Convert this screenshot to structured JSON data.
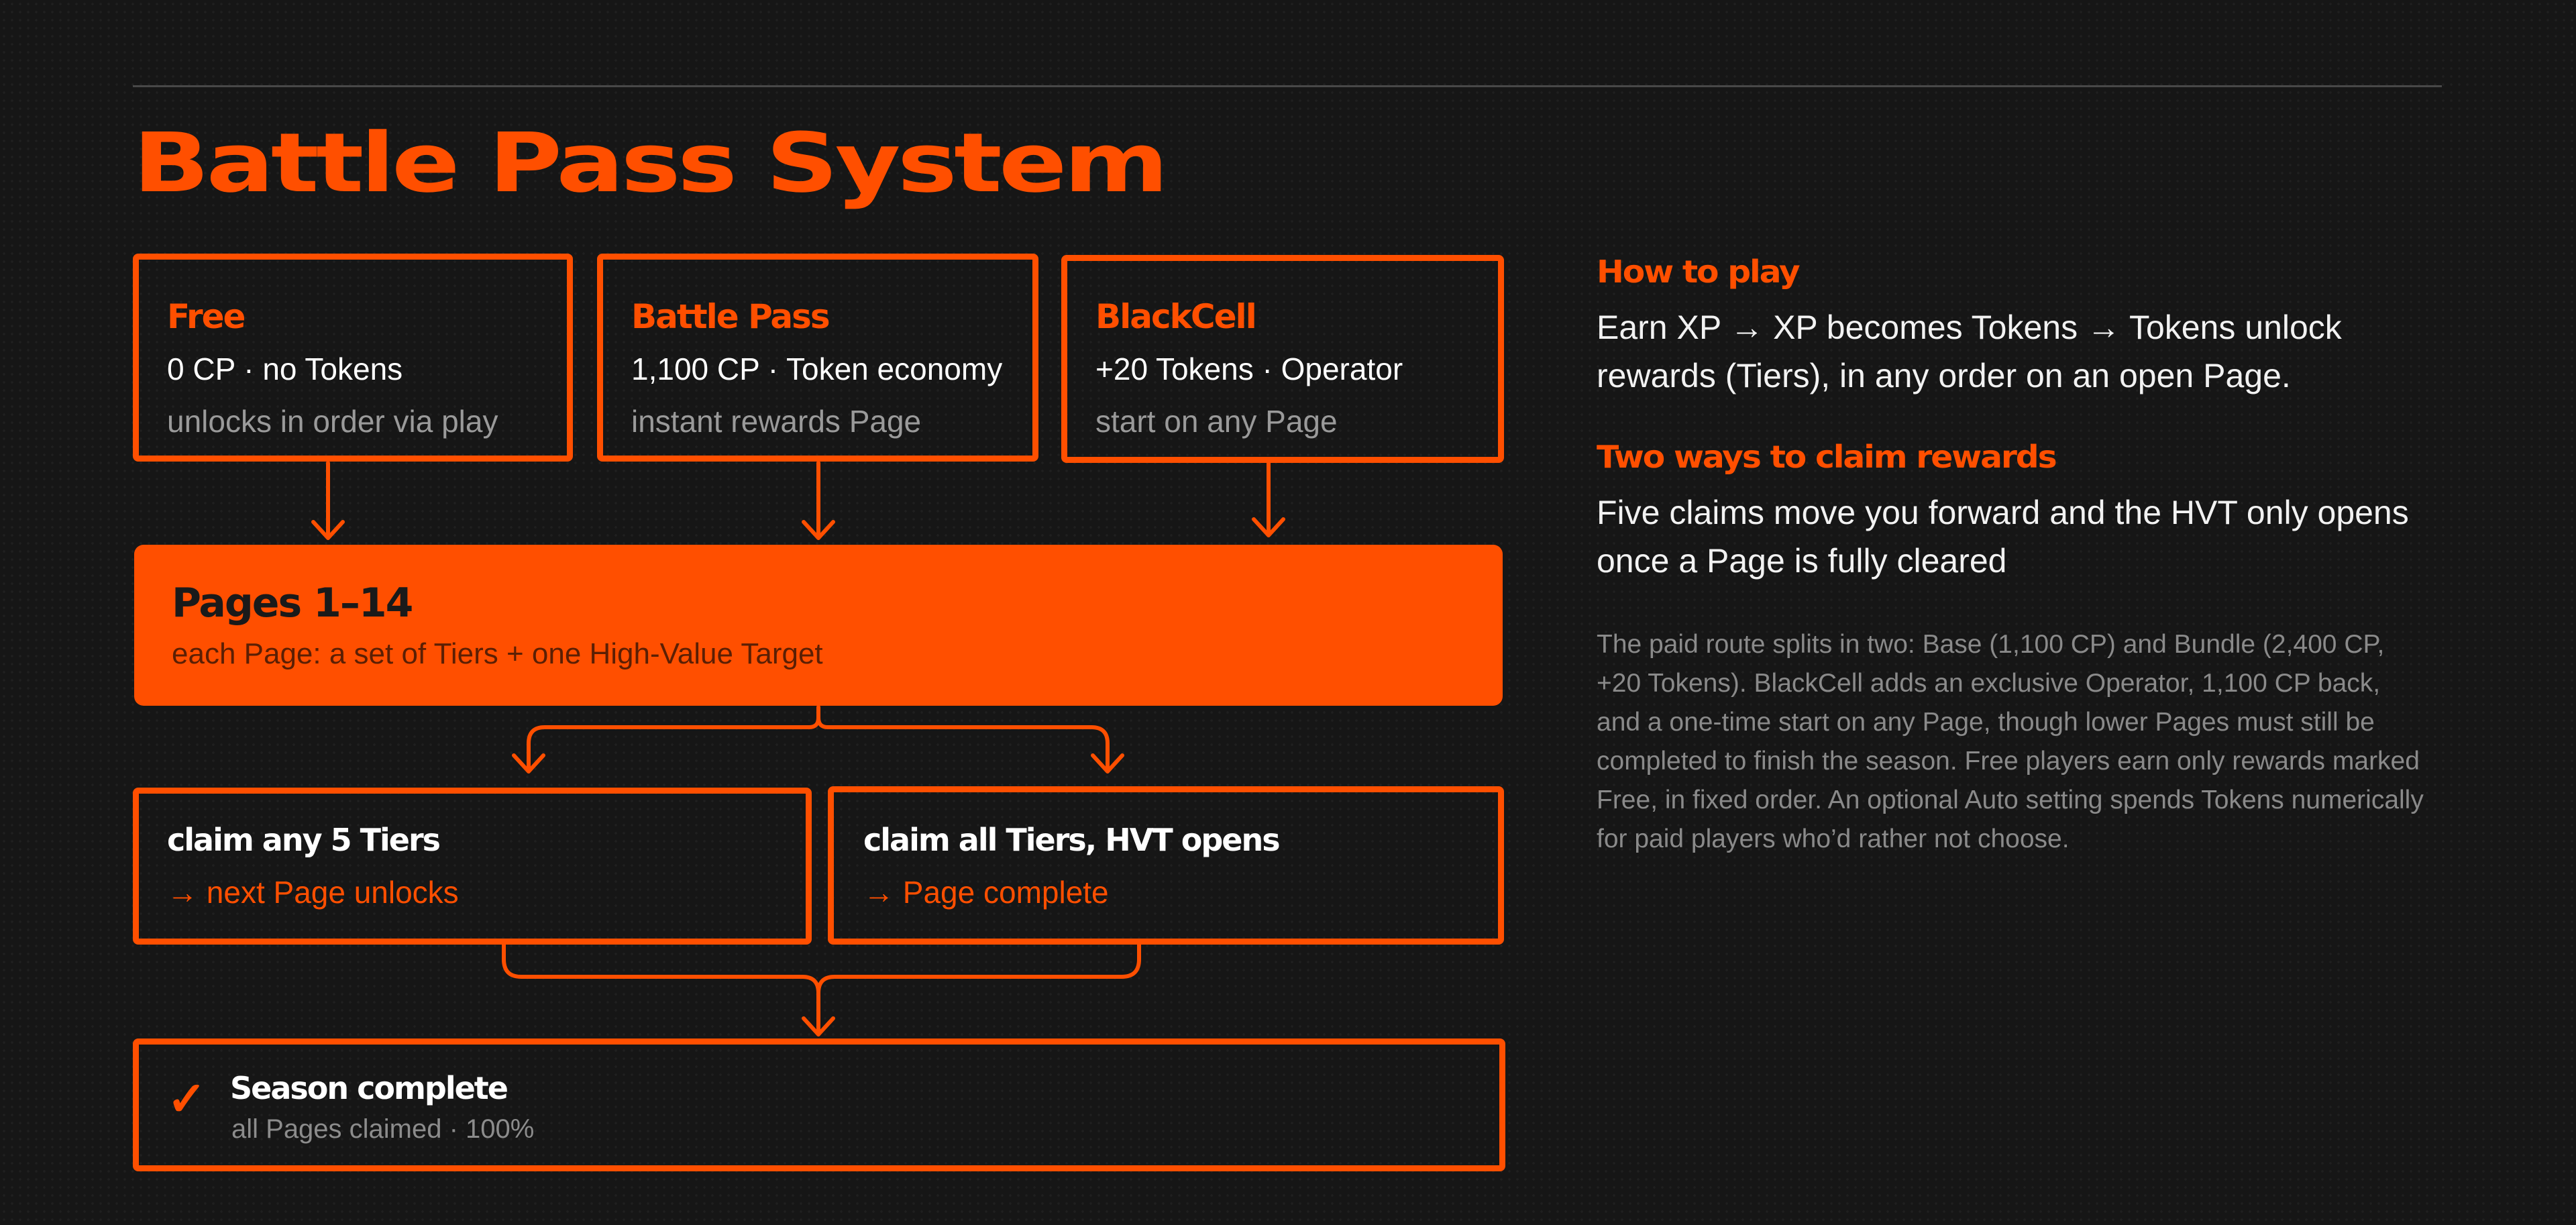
{
  "title": "Battle Pass System",
  "tracks": [
    {
      "name": "Free",
      "line1": "0 CP · no Tokens",
      "line2": "unlocks in order via play"
    },
    {
      "name": "Battle Pass",
      "line1": "1,100 CP · Token economy",
      "line2": "instant rewards Page"
    },
    {
      "name": "BlackCell",
      "line1": "+20 Tokens · Operator",
      "line2": "start on any Page"
    }
  ],
  "pages": {
    "title": "Pages 1–14",
    "subtitle": "each Page: a set of Tiers + one High-Value Target"
  },
  "claims": [
    {
      "title": "claim any 5 Tiers",
      "result": "→ next Page unlocks"
    },
    {
      "title": "claim all Tiers, HVT opens",
      "result": "→ Page complete"
    }
  ],
  "season": {
    "check": "✓",
    "title": "Season complete",
    "subtitle": "all Pages claimed · 100%"
  },
  "side": {
    "how_heading": "How to play",
    "how_text": " Earn XP → XP becomes Tokens → Tokens unlock rewards (Tiers), in any order on an open Page.",
    "ways_heading": "Two ways to claim rewards",
    "ways_text": "Five claims move you forward and the HVT only opens once a Page is fully cleared",
    "details": "The paid route splits in two: Base (1,100 CP) and Bundle (2,400 CP, +20 Tokens). BlackCell adds an exclusive Operator, 1,100 CP back, and a one-time start on any Page, though lower Pages must still be completed to finish the season. Free players earn only rewards marked Free, in fixed order. An optional Auto setting spends Tokens numerically for paid players who’d rather not choose."
  },
  "colors": {
    "accent": "#ff4f00",
    "background": "#161616",
    "text": "#ffffff",
    "muted": "#9a9a9a"
  }
}
